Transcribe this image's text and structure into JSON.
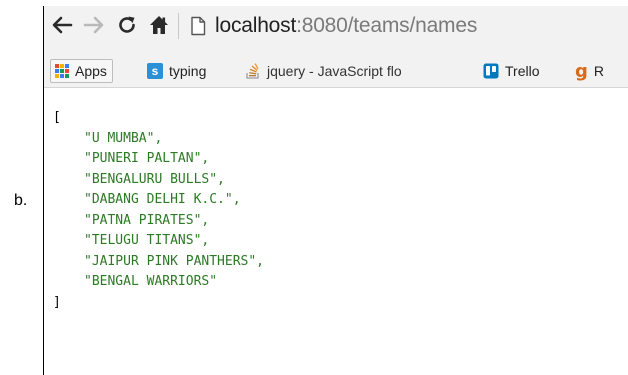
{
  "outer": {
    "label": "b."
  },
  "browser": {
    "url_host": "localhost",
    "url_rest": ":8080/teams/names",
    "icons": {
      "back": "back-arrow-icon",
      "forward": "forward-arrow-icon",
      "reload": "reload-icon",
      "home": "home-icon",
      "page": "page-icon"
    }
  },
  "bookmarks": [
    {
      "label": "Apps",
      "icon": "apps-grid-icon"
    },
    {
      "label": "typing",
      "icon": "s-favicon-icon"
    },
    {
      "label": "jquery - JavaScript flo",
      "icon": "stack-overflow-icon"
    },
    {
      "label": "Trello",
      "icon": "trello-icon"
    },
    {
      "label": "R",
      "icon": "g-favicon-icon"
    }
  ],
  "json_output": {
    "open_bracket": "[",
    "close_bracket": "]",
    "items": [
      "\"U MUMBA\",",
      "\"PUNERI PALTAN\",",
      "\"BENGALURU BULLS\",",
      "\"DABANG DELHI K.C.\",",
      "\"PATNA PIRATES\",",
      "\"TELUGU TITANS\",",
      "\"JAIPUR PINK PANTHERS\",",
      "\"BENGAL WARRIORS\""
    ]
  },
  "colors": {
    "string_green": "#2c7a25",
    "chrome_bg": "#f2f2f2",
    "url_gray": "#7a7a7a"
  }
}
